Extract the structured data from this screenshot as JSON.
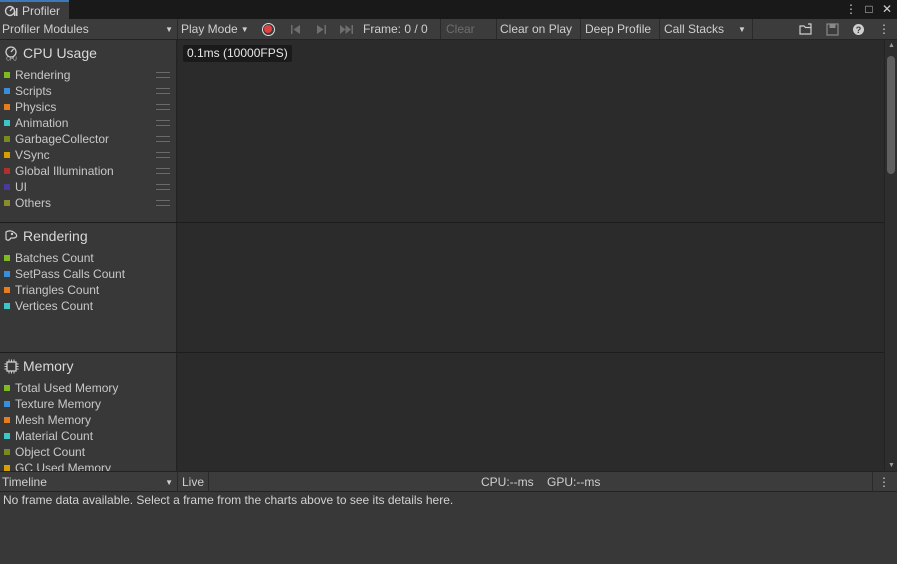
{
  "window": {
    "tab_title": "Profiler",
    "controls": {
      "more": "⋮",
      "maximize": "□",
      "close": "✕"
    }
  },
  "toolbar": {
    "modules_dropdown": "Profiler Modules",
    "play_mode": "Play Mode",
    "frame": "Frame: 0 / 0",
    "clear": "Clear",
    "clear_on_play": "Clear on Play",
    "deep_profile": "Deep Profile",
    "call_stacks": "Call Stacks"
  },
  "cpu_module": {
    "title": "CPU Usage",
    "fps_label": "0.1ms (10000FPS)",
    "items": [
      {
        "label": "Rendering",
        "color": "#7fba1e"
      },
      {
        "label": "Scripts",
        "color": "#3b8dd8"
      },
      {
        "label": "Physics",
        "color": "#e87c1c"
      },
      {
        "label": "Animation",
        "color": "#3dc6c8"
      },
      {
        "label": "GarbageCollector",
        "color": "#7a8a20"
      },
      {
        "label": "VSync",
        "color": "#d6a000"
      },
      {
        "label": "Global Illumination",
        "color": "#b03030"
      },
      {
        "label": "UI",
        "color": "#4a3a9a"
      },
      {
        "label": "Others",
        "color": "#8a8a30"
      }
    ]
  },
  "rendering_module": {
    "title": "Rendering",
    "items": [
      {
        "label": "Batches Count",
        "color": "#7fba1e"
      },
      {
        "label": "SetPass Calls Count",
        "color": "#3b8dd8"
      },
      {
        "label": "Triangles Count",
        "color": "#e87c1c"
      },
      {
        "label": "Vertices Count",
        "color": "#3dc6c8"
      }
    ]
  },
  "memory_module": {
    "title": "Memory",
    "items": [
      {
        "label": "Total Used Memory",
        "color": "#7fba1e"
      },
      {
        "label": "Texture Memory",
        "color": "#3b8dd8"
      },
      {
        "label": "Mesh Memory",
        "color": "#e87c1c"
      },
      {
        "label": "Material Count",
        "color": "#3dc6c8"
      },
      {
        "label": "Object Count",
        "color": "#7a8a20"
      },
      {
        "label": "GC Used Memory",
        "color": "#d6a000"
      }
    ]
  },
  "bottom": {
    "view_dropdown": "Timeline",
    "live": "Live",
    "cpu_time": "CPU:--ms",
    "gpu_time": "GPU:--ms",
    "message": "No frame data available. Select a frame from the charts above to see its details here."
  }
}
